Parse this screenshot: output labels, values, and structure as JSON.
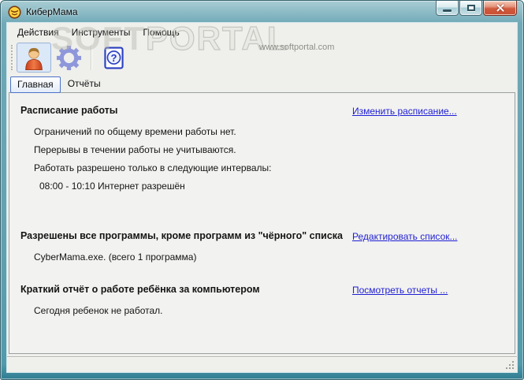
{
  "window": {
    "title": "КиберМама"
  },
  "menu": {
    "items": [
      {
        "label": "Действия"
      },
      {
        "label": "Инструменты"
      },
      {
        "label": "Помощь"
      }
    ]
  },
  "watermark": {
    "part1": "SOFT",
    "part2": "PORTAL",
    "url": "www.softportal.com"
  },
  "toolbar": {
    "buttons": [
      {
        "icon": "user-icon"
      },
      {
        "icon": "gear-icon"
      },
      {
        "icon": "help-icon"
      }
    ]
  },
  "tabs": [
    {
      "label": "Главная",
      "active": true
    },
    {
      "label": "Отчёты",
      "active": false
    }
  ],
  "main": {
    "sections": [
      {
        "heading": "Расписание работы",
        "link": "Изменить расписание...",
        "lines": [
          "Ограничений по общему времени работы нет.",
          "Перерывы в течении работы не учитываются.",
          "Работать разрешено только в следующие интервалы:"
        ],
        "interval": "08:00 - 10:10 Интернет разрешён"
      },
      {
        "heading": "Разрешены все программы, кроме программ из \"чёрного\" списка",
        "link": "Редактировать список...",
        "lines": [
          "CyberMama.exe. (всего 1 программа)"
        ]
      },
      {
        "heading": "Краткий отчёт о работе ребёнка за компьютером",
        "link": "Посмотреть отчеты ...",
        "lines": [
          "Сегодня ребенок не работал."
        ]
      }
    ]
  },
  "colors": {
    "frame_teal": "#63a1b0",
    "close_red": "#c94f33",
    "link_blue": "#1f1fd4",
    "active_tab_border": "#4a73c8",
    "watermark_gray": "#c7c7c1"
  }
}
